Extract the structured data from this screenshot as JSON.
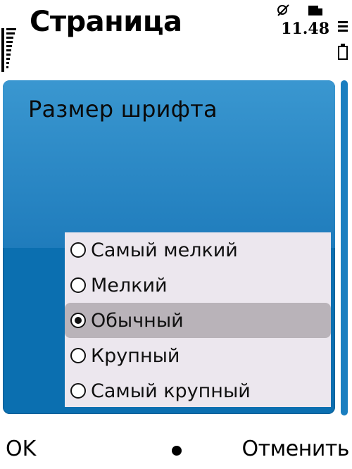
{
  "header": {
    "title": "Страница",
    "time": "11.48"
  },
  "dialog": {
    "title": "Размер шрифта",
    "options": [
      {
        "label": "Самый мелкий",
        "checked": false
      },
      {
        "label": "Мелкий",
        "checked": false
      },
      {
        "label": "Обычный",
        "checked": true
      },
      {
        "label": "Крупный",
        "checked": false
      },
      {
        "label": "Самый крупный",
        "checked": false
      }
    ]
  },
  "softkeys": {
    "left": "OK",
    "right": "Отменить"
  },
  "colors": {
    "panel": "#0b6fb0",
    "list_bg": "#ece7ee",
    "selected_row": "#b9b3b9"
  }
}
